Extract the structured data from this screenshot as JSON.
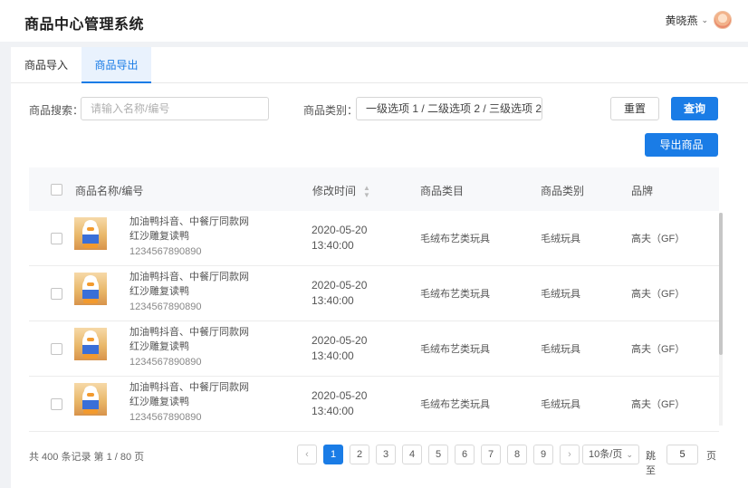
{
  "app": {
    "title": "商品中心管理系统",
    "user_name": "黄晓燕"
  },
  "tabs": [
    {
      "label": "商品导入"
    },
    {
      "label": "商品导出"
    }
  ],
  "filters": {
    "search_label": "商品搜索：",
    "search_placeholder": "请输入名称/编号",
    "category_label": "商品类别：",
    "category_value": "一级选项 1 / 二级选项 2 / 三级选项 2"
  },
  "buttons": {
    "reset": "重置",
    "query": "查询",
    "export": "导出商品"
  },
  "table": {
    "columns": [
      "商品名称/编号",
      "修改时间",
      "商品类目",
      "商品类别",
      "品牌"
    ],
    "rows": [
      {
        "name_line1": "加油鸭抖音、中餐厅同款网",
        "name_line2": "红沙雕复读鸭",
        "code": "1234567890890",
        "time_date": "2020-05-20",
        "time_clock": "13:40:00",
        "category": "毛绒布艺类玩具",
        "type": "毛绒玩具",
        "brand": "高夫（GF）"
      },
      {
        "name_line1": "加油鸭抖音、中餐厅同款网",
        "name_line2": "红沙雕复读鸭",
        "code": "1234567890890",
        "time_date": "2020-05-20",
        "time_clock": "13:40:00",
        "category": "毛绒布艺类玩具",
        "type": "毛绒玩具",
        "brand": "高夫（GF）"
      },
      {
        "name_line1": "加油鸭抖音、中餐厅同款网",
        "name_line2": "红沙雕复读鸭",
        "code": "1234567890890",
        "time_date": "2020-05-20",
        "time_clock": "13:40:00",
        "category": "毛绒布艺类玩具",
        "type": "毛绒玩具",
        "brand": "高夫（GF）"
      },
      {
        "name_line1": "加油鸭抖音、中餐厅同款网",
        "name_line2": "红沙雕复读鸭",
        "code": "1234567890890",
        "time_date": "2020-05-20",
        "time_clock": "13:40:00",
        "category": "毛绒布艺类玩具",
        "type": "毛绒玩具",
        "brand": "高夫（GF）"
      }
    ]
  },
  "pagination": {
    "summary": "共 400 条记录 第 1 / 80 页",
    "pages": [
      "1",
      "2",
      "3",
      "4",
      "5",
      "6",
      "7",
      "8",
      "9"
    ],
    "current": "1",
    "page_size": "10条/页",
    "jump_label": "跳至",
    "jump_value": "5",
    "page_unit": "页"
  },
  "colors": {
    "primary": "#1a7ce6"
  }
}
